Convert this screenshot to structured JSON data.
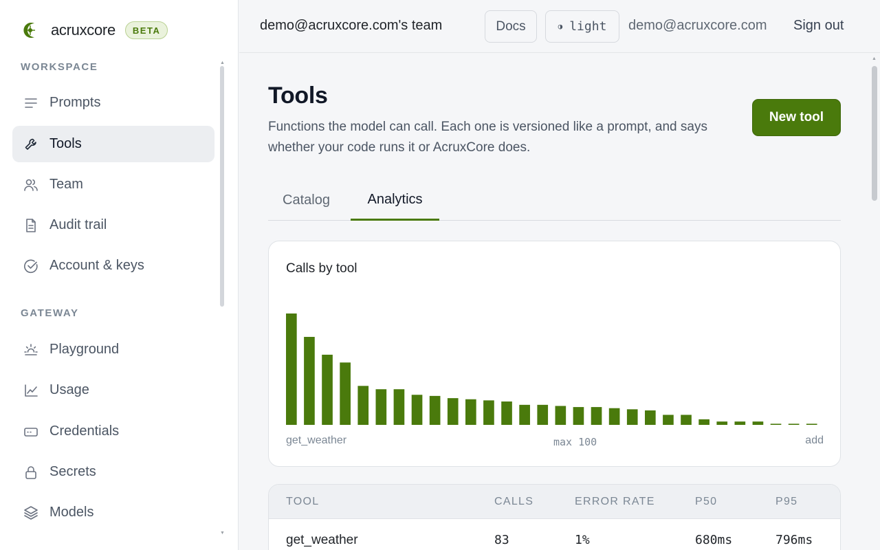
{
  "brand": {
    "name": "acruxcore",
    "badge": "BETA",
    "accent": "#4a7a0c"
  },
  "sidebar": {
    "sections": [
      {
        "label": "WORKSPACE",
        "items": [
          {
            "label": "Prompts",
            "icon": "lines-icon"
          },
          {
            "label": "Tools",
            "icon": "wrench-icon",
            "active": true
          },
          {
            "label": "Team",
            "icon": "users-icon"
          },
          {
            "label": "Audit trail",
            "icon": "document-icon"
          },
          {
            "label": "Account & keys",
            "icon": "check-circle-icon"
          }
        ]
      },
      {
        "label": "GATEWAY",
        "items": [
          {
            "label": "Playground",
            "icon": "sun-icon"
          },
          {
            "label": "Usage",
            "icon": "line-chart-icon"
          },
          {
            "label": "Credentials",
            "icon": "card-icon"
          },
          {
            "label": "Secrets",
            "icon": "lock-icon"
          },
          {
            "label": "Models",
            "icon": "layers-icon"
          }
        ]
      }
    ]
  },
  "topbar": {
    "team": "demo@acruxcore.com's team",
    "docs": "Docs",
    "theme": "light",
    "email": "demo@acruxcore.com",
    "signout": "Sign out"
  },
  "page": {
    "title": "Tools",
    "description": "Functions the model can call. Each one is versioned like a prompt, and says whether your code runs it or AcruxCore does.",
    "new_tool": "New tool",
    "tabs": [
      {
        "label": "Catalog"
      },
      {
        "label": "Analytics",
        "active": true
      }
    ]
  },
  "chart_data": {
    "type": "bar",
    "title": "Calls by tool",
    "first_label": "get_weather",
    "last_label": "add",
    "max_label": "max 100",
    "color": "#4a7a0c",
    "values": [
      100,
      79,
      63,
      56,
      35,
      32,
      32,
      27,
      26,
      24,
      23,
      22,
      21,
      18,
      18,
      17,
      16,
      16,
      15,
      14,
      13,
      9,
      9,
      5,
      3,
      3,
      3,
      1,
      1,
      1
    ],
    "ylim": [
      0,
      100
    ]
  },
  "table": {
    "columns": [
      "TOOL",
      "CALLS",
      "ERROR RATE",
      "P50",
      "P95"
    ],
    "rows": [
      [
        "get_weather",
        "83",
        "1%",
        "680ms",
        "796ms"
      ]
    ]
  }
}
